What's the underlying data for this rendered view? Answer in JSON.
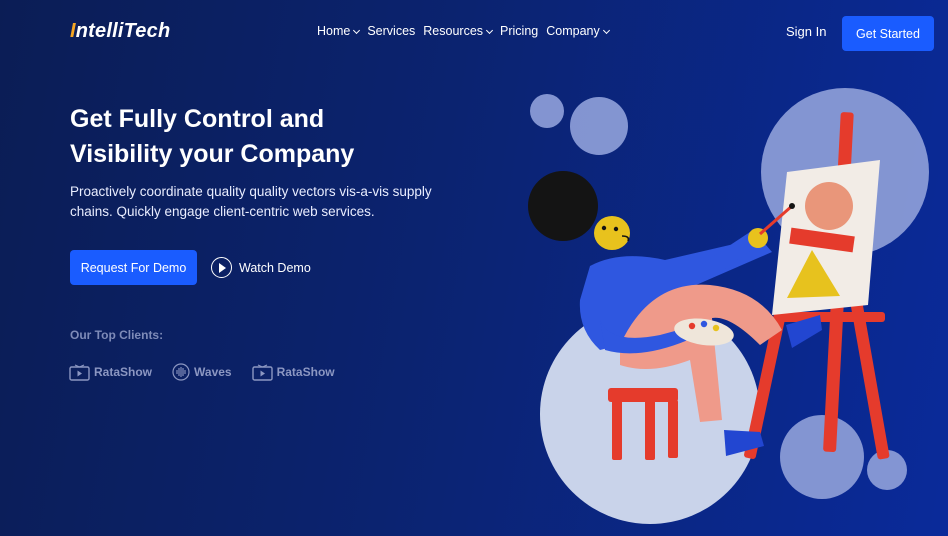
{
  "brand": {
    "first_letter": "I",
    "rest": "ntelliTech"
  },
  "nav": {
    "items": [
      {
        "label": "Home",
        "dropdown": true
      },
      {
        "label": "Services",
        "dropdown": false
      },
      {
        "label": "Resources",
        "dropdown": true
      },
      {
        "label": "Pricing",
        "dropdown": false
      },
      {
        "label": "Company",
        "dropdown": true
      }
    ],
    "sign_in": "Sign In",
    "get_started": "Get Started"
  },
  "hero": {
    "title_line1": "Get Fully Control and",
    "title_line2": "Visibility your Company",
    "subtitle": "Proactively coordinate quality quality vectors vis-a-vis supply chains. Quickly engage client-centric web services.",
    "primary_cta": "Request For Demo",
    "secondary_cta": "Watch Demo"
  },
  "clients": {
    "label": "Our Top Clients:",
    "items": [
      {
        "name": "RataShow",
        "icon": "tv-play-icon"
      },
      {
        "name": "Waves",
        "icon": "waves-icon"
      },
      {
        "name": "RataShow",
        "icon": "tv-play-icon"
      }
    ]
  },
  "colors": {
    "accent": "#1a5cff",
    "logo_letter": "#f5a623",
    "bg_dark": "#0b1d55",
    "bg_light": "#0a2a9a"
  }
}
